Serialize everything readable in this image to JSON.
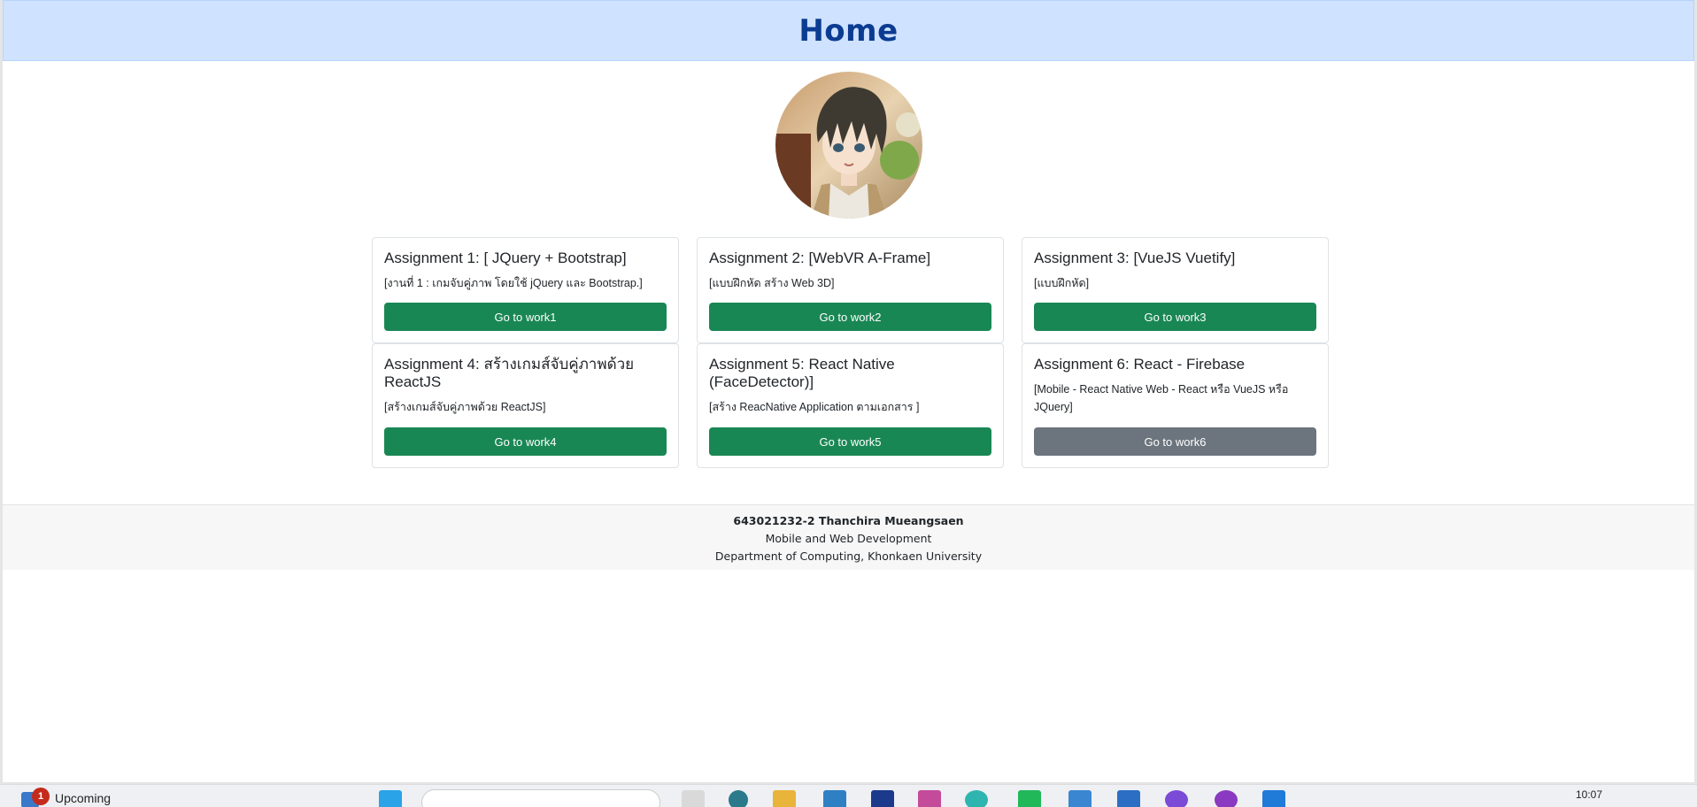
{
  "header": {
    "title": "Home"
  },
  "avatar": {
    "icon": "avatar-anime-boy"
  },
  "cards": [
    {
      "title": "Assignment 1: [ JQuery + Bootstrap]",
      "desc": "[งานที่ 1 : เกมจับคู่ภาพ โดยใช้ jQuery และ Bootstrap.]",
      "button": "Go to work1",
      "enabled": true
    },
    {
      "title": "Assignment 2: [WebVR A-Frame]",
      "desc": "[แบบฝึกหัด สร้าง Web 3D]",
      "button": "Go to work2",
      "enabled": true
    },
    {
      "title": "Assignment 3: [VueJS Vuetify]",
      "desc": "[แบบฝึกหัด]",
      "button": "Go to work3",
      "enabled": true
    },
    {
      "title": "Assignment 4: สร้างเกมส์จับคู่ภาพด้วย ReactJS",
      "desc": "[สร้างเกมส์จับคู่ภาพด้วย ReactJS]",
      "button": "Go to work4",
      "enabled": true
    },
    {
      "title": "Assignment 5: React Native (FaceDetector)]",
      "desc": "[สร้าง ReacNative Application ตามเอกสาร ]",
      "button": "Go to work5",
      "enabled": true
    },
    {
      "title": "Assignment 6: React - Firebase",
      "desc": "[Mobile - React Native Web - React หรือ VueJS หรือ JQuery]",
      "button": "Go to work6",
      "enabled": false
    }
  ],
  "footer": {
    "name": "643021232-2 Thanchira Mueangsaen",
    "course": "Mobile and Web Development",
    "department": "Department of Computing, Khonkaen University"
  },
  "taskbar": {
    "badge": "1",
    "upcoming": "Upcoming",
    "time": "10:07"
  },
  "colors": {
    "header_bg": "#cfe2ff",
    "title": "#0b3c91",
    "success": "#198754",
    "secondary": "#6c757d"
  }
}
